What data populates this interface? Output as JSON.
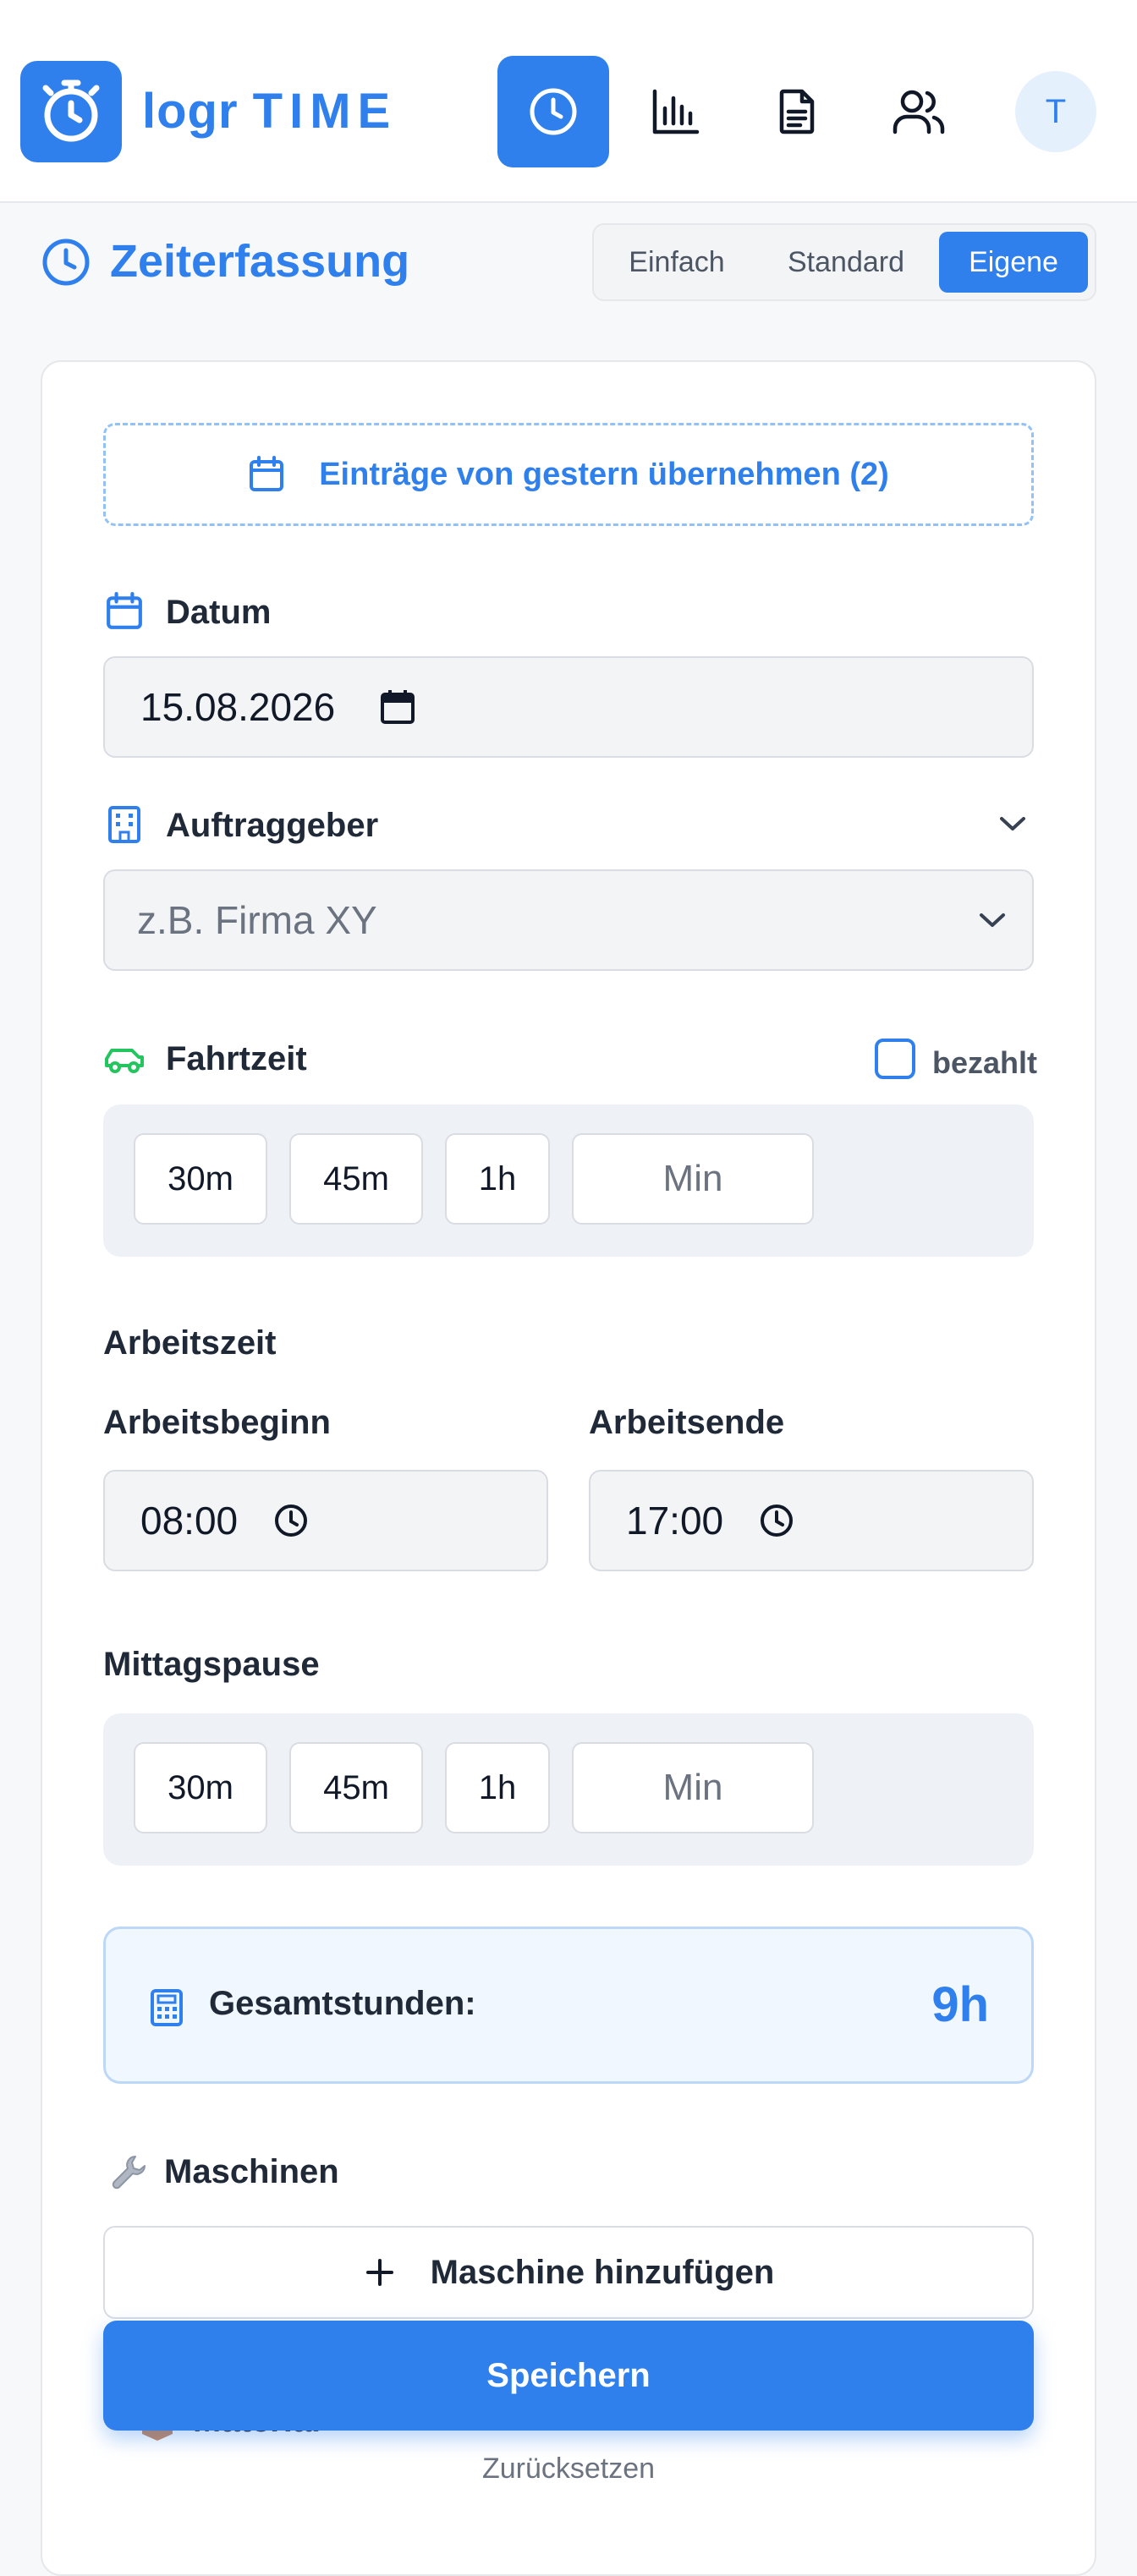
{
  "header": {
    "logo_word1": "logr",
    "logo_word2": "TIME",
    "nav": [
      {
        "icon": "clock-icon",
        "active": true
      },
      {
        "icon": "bar-chart-icon",
        "active": false
      },
      {
        "icon": "document-icon",
        "active": false
      },
      {
        "icon": "users-icon",
        "active": false
      }
    ],
    "avatar_initial": "T"
  },
  "page": {
    "title": "Zeiterfassung",
    "modes": [
      "Einfach",
      "Standard",
      "Eigene"
    ],
    "active_mode": "Eigene"
  },
  "form": {
    "copy_entries_label": "Einträge von gestern übernehmen (2)",
    "date_label": "Datum",
    "date_value": "15.08.2026",
    "client_label": "Auftraggeber",
    "client_placeholder": "z.B. Firma XY",
    "travel_label": "Fahrtzeit",
    "travel_paid_label": "bezahlt",
    "travel_paid_checked": false,
    "travel_presets": [
      "30m",
      "45m",
      "1h"
    ],
    "travel_min_placeholder": "Min",
    "worktime_heading": "Arbeitszeit",
    "start_label": "Arbeitsbeginn",
    "start_value": "08:00",
    "end_label": "Arbeitsende",
    "end_value": "17:00",
    "lunch_label": "Mittagspause",
    "lunch_presets": [
      "30m",
      "45m",
      "1h"
    ],
    "lunch_min_placeholder": "Min",
    "total_label": "Gesamtstunden:",
    "total_value": "9h",
    "machines_label": "Maschinen",
    "add_machine_label": "Maschine hinzufügen",
    "material_label": "Material",
    "save_label": "Speichern",
    "reset_label": "Zurücksetzen"
  },
  "colors": {
    "accent": "#2f80ed",
    "travel_icon": "#22c55e"
  }
}
